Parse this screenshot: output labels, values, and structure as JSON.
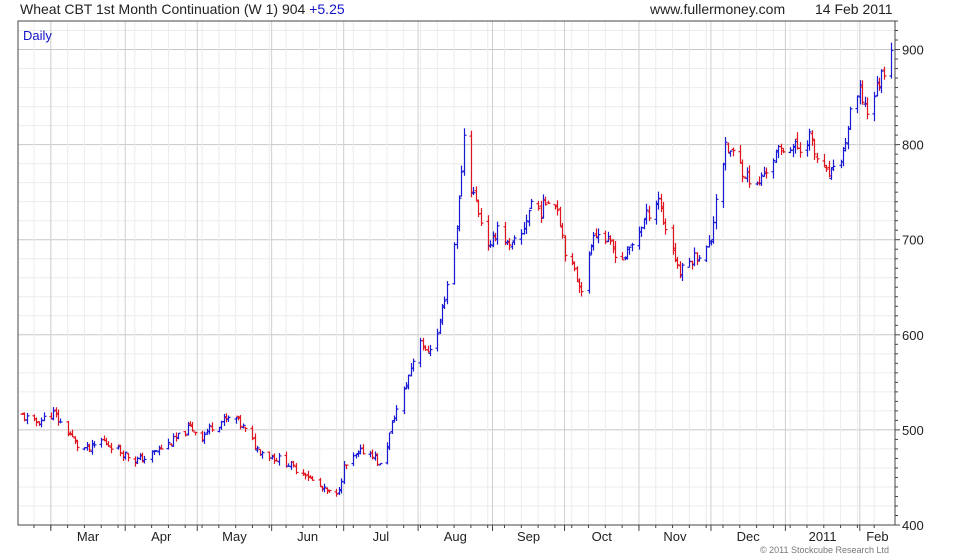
{
  "header": {
    "title": "Wheat CBT 1st Month Continuation (W 1) 904",
    "change": "+5.25",
    "site": "www.fullermoney.com",
    "date": "14 Feb 2011"
  },
  "footer": {
    "copyright": "© 2011 Stockcube Research Ltd"
  },
  "colors": {
    "up": "#1a1ad6",
    "down": "#e0141e",
    "grid": "#d3d3d3",
    "frame": "#444444",
    "label_period": "#1515c8"
  },
  "chart_data": {
    "type": "ohlc",
    "period_label": "Daily",
    "ylim": [
      400,
      930
    ],
    "y_ticks": [
      400,
      500,
      600,
      700,
      800,
      900
    ],
    "x_start": "2010-02-17",
    "x_end": "2011-02-14",
    "x_labels": [
      {
        "label": "Mar",
        "date": "2010-03-01"
      },
      {
        "label": "Apr",
        "date": "2010-04-01"
      },
      {
        "label": "May",
        "date": "2010-05-01"
      },
      {
        "label": "Jun",
        "date": "2010-06-01"
      },
      {
        "label": "Jul",
        "date": "2010-07-01"
      },
      {
        "label": "Aug",
        "date": "2010-08-01"
      },
      {
        "label": "Sep",
        "date": "2010-09-01"
      },
      {
        "label": "Oct",
        "date": "2010-10-01"
      },
      {
        "label": "Nov",
        "date": "2010-11-01"
      },
      {
        "label": "Dec",
        "date": "2010-12-01"
      },
      {
        "label": "2011",
        "date": "2011-01-01"
      },
      {
        "label": "Feb",
        "date": "2011-02-01"
      }
    ],
    "price_path": [
      [
        "2010-02-17",
        515
      ],
      [
        "2010-02-22",
        507
      ],
      [
        "2010-02-26",
        512
      ],
      [
        "2010-03-02",
        517
      ],
      [
        "2010-03-05",
        507
      ],
      [
        "2010-03-09",
        495
      ],
      [
        "2010-03-12",
        483
      ],
      [
        "2010-03-17",
        479
      ],
      [
        "2010-03-22",
        489
      ],
      [
        "2010-03-26",
        484
      ],
      [
        "2010-03-31",
        476
      ],
      [
        "2010-04-05",
        468
      ],
      [
        "2010-04-09",
        470
      ],
      [
        "2010-04-14",
        478
      ],
      [
        "2010-04-19",
        485
      ],
      [
        "2010-04-23",
        492
      ],
      [
        "2010-04-28",
        503
      ],
      [
        "2010-05-03",
        493
      ],
      [
        "2010-05-07",
        504
      ],
      [
        "2010-05-12",
        510
      ],
      [
        "2010-05-17",
        512
      ],
      [
        "2010-05-21",
        499
      ],
      [
        "2010-05-26",
        480
      ],
      [
        "2010-06-01",
        472
      ],
      [
        "2010-06-07",
        466
      ],
      [
        "2010-06-10",
        460
      ],
      [
        "2010-06-15",
        455
      ],
      [
        "2010-06-18",
        446
      ],
      [
        "2010-06-23",
        436
      ],
      [
        "2010-06-28",
        430
      ],
      [
        "2010-07-01",
        460
      ],
      [
        "2010-07-06",
        472
      ],
      [
        "2010-07-09",
        478
      ],
      [
        "2010-07-13",
        475
      ],
      [
        "2010-07-16",
        462
      ],
      [
        "2010-07-19",
        485
      ],
      [
        "2010-07-22",
        515
      ],
      [
        "2010-07-26",
        540
      ],
      [
        "2010-07-29",
        566
      ],
      [
        "2010-08-02",
        597
      ],
      [
        "2010-08-04",
        580
      ],
      [
        "2010-08-09",
        600
      ],
      [
        "2010-08-12",
        640
      ],
      [
        "2010-08-16",
        695
      ],
      [
        "2010-08-18",
        740
      ],
      [
        "2010-08-20",
        810
      ],
      [
        "2010-08-23",
        755
      ],
      [
        "2010-08-25",
        740
      ],
      [
        "2010-08-27",
        720
      ],
      [
        "2010-08-31",
        690
      ],
      [
        "2010-09-03",
        715
      ],
      [
        "2010-09-08",
        690
      ],
      [
        "2010-09-13",
        705
      ],
      [
        "2010-09-17",
        740
      ],
      [
        "2010-09-21",
        730
      ],
      [
        "2010-09-24",
        745
      ],
      [
        "2010-09-28",
        735
      ],
      [
        "2010-10-01",
        690
      ],
      [
        "2010-10-05",
        665
      ],
      [
        "2010-10-08",
        650
      ],
      [
        "2010-10-11",
        680
      ],
      [
        "2010-10-13",
        710
      ],
      [
        "2010-10-18",
        700
      ],
      [
        "2010-10-21",
        690
      ],
      [
        "2010-10-25",
        680
      ],
      [
        "2010-10-28",
        690
      ],
      [
        "2010-11-01",
        710
      ],
      [
        "2010-11-04",
        725
      ],
      [
        "2010-11-09",
        745
      ],
      [
        "2010-11-11",
        720
      ],
      [
        "2010-11-15",
        690
      ],
      [
        "2010-11-18",
        665
      ],
      [
        "2010-11-23",
        680
      ],
      [
        "2010-11-29",
        690
      ],
      [
        "2010-12-01",
        700
      ],
      [
        "2010-12-03",
        745
      ],
      [
        "2010-12-07",
        795
      ],
      [
        "2010-12-10",
        790
      ],
      [
        "2010-12-15",
        770
      ],
      [
        "2010-12-20",
        755
      ],
      [
        "2010-12-23",
        770
      ],
      [
        "2010-12-28",
        790
      ],
      [
        "2011-01-03",
        800
      ],
      [
        "2011-01-07",
        795
      ],
      [
        "2011-01-11",
        810
      ],
      [
        "2011-01-13",
        790
      ],
      [
        "2011-01-18",
        768
      ],
      [
        "2011-01-21",
        770
      ],
      [
        "2011-01-25",
        792
      ],
      [
        "2011-01-28",
        830
      ],
      [
        "2011-02-01",
        855
      ],
      [
        "2011-02-04",
        835
      ],
      [
        "2011-02-08",
        860
      ],
      [
        "2011-02-11",
        880
      ],
      [
        "2011-02-14",
        904
      ]
    ]
  }
}
